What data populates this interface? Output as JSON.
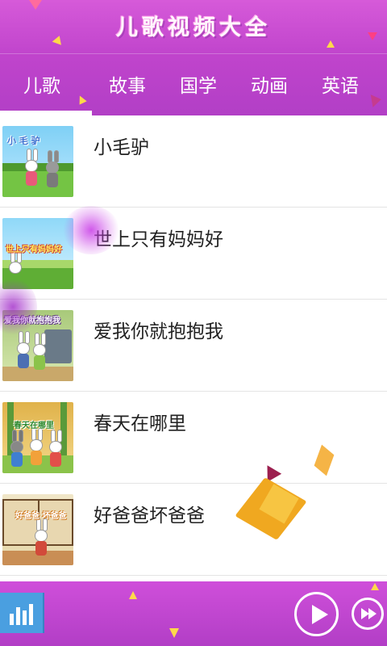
{
  "app": {
    "title": "儿歌视频大全"
  },
  "tabs": [
    {
      "label": "儿歌",
      "selected": true
    },
    {
      "label": "故事",
      "selected": false
    },
    {
      "label": "国学",
      "selected": false
    },
    {
      "label": "动画",
      "selected": false
    },
    {
      "label": "英语",
      "selected": false
    }
  ],
  "songs": [
    {
      "title": "小毛驴",
      "thumb_text": "小 毛 驴"
    },
    {
      "title": "世上只有妈妈好",
      "thumb_text": "世上只有妈妈好"
    },
    {
      "title": "爱我你就抱抱我",
      "thumb_text": "爱我你就抱抱我"
    },
    {
      "title": "春天在哪里",
      "thumb_text": "春天在哪里"
    },
    {
      "title": "好爸爸坏爸爸",
      "thumb_text": "好爸爸 坏爸爸"
    }
  ],
  "player": {
    "equalizer_icon": "equalizer-icon",
    "play_icon": "play-icon",
    "next_icon": "fast-forward-icon"
  },
  "colors": {
    "header": "#c044cc",
    "player": "#b23ec6",
    "accent_blue": "#4a9fe0",
    "text": "#222222"
  }
}
